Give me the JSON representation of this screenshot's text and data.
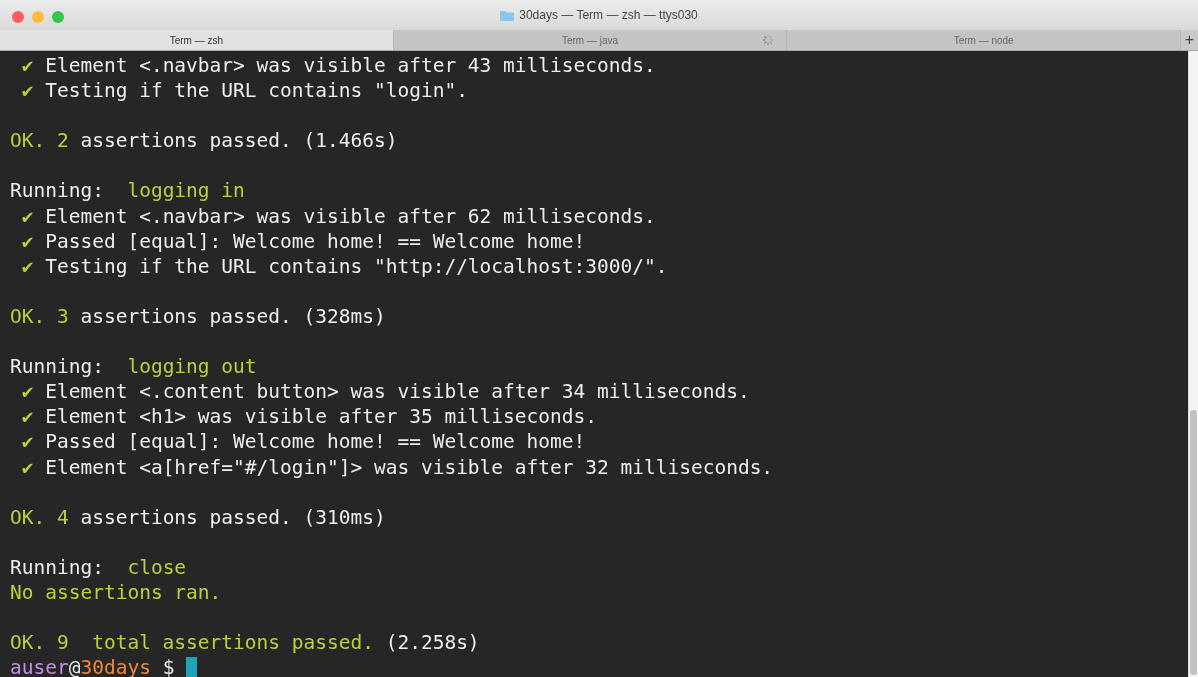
{
  "window": {
    "title": "30days — Term — zsh — ttys030"
  },
  "tabs": [
    {
      "label": "Term — zsh",
      "selected": true,
      "busy": false
    },
    {
      "label": "Term — java",
      "selected": false,
      "busy": true
    },
    {
      "label": "Term — node",
      "selected": false,
      "busy": false
    }
  ],
  "new_tab_button": "+",
  "terminal": {
    "lines": [
      {
        "kind": "text",
        "segments": [
          {
            "kind": "check",
            "text": " ✔ "
          },
          {
            "kind": "plain",
            "text": "Element <.navbar> was visible after 43 milliseconds."
          }
        ]
      },
      {
        "kind": "text",
        "segments": [
          {
            "kind": "check",
            "text": " ✔ "
          },
          {
            "kind": "plain",
            "text": "Testing if the URL contains \"login\"."
          }
        ]
      },
      {
        "kind": "blank"
      },
      {
        "kind": "text",
        "segments": [
          {
            "kind": "accent",
            "text": "OK. 2 "
          },
          {
            "kind": "plain",
            "text": "assertions passed. (1.466s)"
          }
        ]
      },
      {
        "kind": "blank"
      },
      {
        "kind": "text",
        "segments": [
          {
            "kind": "plain",
            "text": "Running:  "
          },
          {
            "kind": "accent",
            "text": "logging in"
          }
        ]
      },
      {
        "kind": "text",
        "segments": [
          {
            "kind": "check",
            "text": " ✔ "
          },
          {
            "kind": "plain",
            "text": "Element <.navbar> was visible after 62 milliseconds."
          }
        ]
      },
      {
        "kind": "text",
        "segments": [
          {
            "kind": "check",
            "text": " ✔ "
          },
          {
            "kind": "plain",
            "text": "Passed [equal]: Welcome home! == Welcome home!"
          }
        ]
      },
      {
        "kind": "text",
        "segments": [
          {
            "kind": "check",
            "text": " ✔ "
          },
          {
            "kind": "plain",
            "text": "Testing if the URL contains \"http://localhost:3000/\"."
          }
        ]
      },
      {
        "kind": "blank"
      },
      {
        "kind": "text",
        "segments": [
          {
            "kind": "accent",
            "text": "OK. 3 "
          },
          {
            "kind": "plain",
            "text": "assertions passed. (328ms)"
          }
        ]
      },
      {
        "kind": "blank"
      },
      {
        "kind": "text",
        "segments": [
          {
            "kind": "plain",
            "text": "Running:  "
          },
          {
            "kind": "accent",
            "text": "logging out"
          }
        ]
      },
      {
        "kind": "text",
        "segments": [
          {
            "kind": "check",
            "text": " ✔ "
          },
          {
            "kind": "plain",
            "text": "Element <.content button> was visible after 34 milliseconds."
          }
        ]
      },
      {
        "kind": "text",
        "segments": [
          {
            "kind": "check",
            "text": " ✔ "
          },
          {
            "kind": "plain",
            "text": "Element <h1> was visible after 35 milliseconds."
          }
        ]
      },
      {
        "kind": "text",
        "segments": [
          {
            "kind": "check",
            "text": " ✔ "
          },
          {
            "kind": "plain",
            "text": "Passed [equal]: Welcome home! == Welcome home!"
          }
        ]
      },
      {
        "kind": "text",
        "segments": [
          {
            "kind": "check",
            "text": " ✔ "
          },
          {
            "kind": "plain",
            "text": "Element <a[href=\"#/login\"]> was visible after 32 milliseconds."
          }
        ]
      },
      {
        "kind": "blank"
      },
      {
        "kind": "text",
        "segments": [
          {
            "kind": "accent",
            "text": "OK. 4 "
          },
          {
            "kind": "plain",
            "text": "assertions passed. (310ms)"
          }
        ]
      },
      {
        "kind": "blank"
      },
      {
        "kind": "text",
        "segments": [
          {
            "kind": "plain",
            "text": "Running:  "
          },
          {
            "kind": "accent",
            "text": "close"
          }
        ]
      },
      {
        "kind": "text",
        "segments": [
          {
            "kind": "accent",
            "text": "No assertions ran."
          }
        ]
      },
      {
        "kind": "blank"
      },
      {
        "kind": "text",
        "segments": [
          {
            "kind": "accent",
            "text": "OK. 9  total assertions passed. "
          },
          {
            "kind": "plain",
            "text": "(2.258s)"
          }
        ]
      },
      {
        "kind": "prompt",
        "segments": [
          {
            "kind": "user",
            "text": "auser"
          },
          {
            "kind": "plain",
            "text": "@"
          },
          {
            "kind": "host",
            "text": "30days"
          },
          {
            "kind": "plain",
            "text": " $ "
          }
        ]
      }
    ]
  }
}
